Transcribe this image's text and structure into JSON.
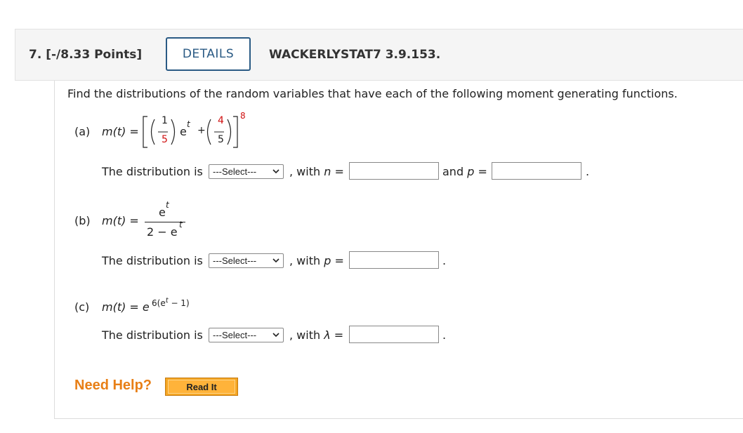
{
  "header": {
    "question_title": "7. [-/8.33 Points]",
    "details_label": "DETAILS",
    "question_code": "WACKERLYSTAT7 3.9.153."
  },
  "prompt": "Find the distributions of the random variables that have each of the following moment generating functions.",
  "parts": {
    "a": {
      "label": "(a)",
      "mgf_lhs": "m(t) =",
      "frac1_num": "1",
      "frac1_den": "5",
      "frac2_num": "4",
      "frac2_den": "5",
      "et": "e",
      "t": "t",
      "plus": "+",
      "exponent": "8",
      "distribution_text": "The distribution is",
      "select_value": "---Select---",
      "with_text": ", with",
      "param1": "n",
      "param1_eq": "=",
      "and_text": "and",
      "param2": "p",
      "param2_eq": "=",
      "period": "."
    },
    "b": {
      "label": "(b)",
      "mgf_lhs": "m(t) =",
      "num_e": "e",
      "num_t": "t",
      "den_text": "2 − e",
      "den_t": "t",
      "distribution_text": "The distribution is",
      "select_value": "---Select---",
      "with_text": ", with",
      "param1": "p",
      "param1_eq": "=",
      "period": "."
    },
    "c": {
      "label": "(c)",
      "mgf_lhs": "m(t) = e",
      "exp_text": "6(e",
      "exp_t": "t",
      "exp_tail": " − 1)",
      "distribution_text": "The distribution is",
      "select_value": "---Select---",
      "with_text": ", with",
      "param1": "λ",
      "param1_eq": "=",
      "period": "."
    }
  },
  "help": {
    "need_help": "Need Help?",
    "read_it": "Read It"
  },
  "colors": {
    "details_border": "#2a5a84",
    "highlight_red": "#d01010",
    "help_orange": "#e87f16",
    "read_it_bg": "#ffb33a"
  }
}
